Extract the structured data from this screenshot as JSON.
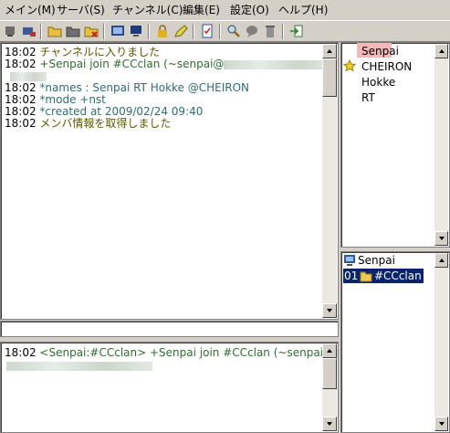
{
  "menu": [
    "メイン(M)",
    "サーバ(S)",
    "チャンネル(C)",
    "編集(E)",
    "設定(O)",
    "ヘルプ(H)"
  ],
  "toolbar_icons": [
    "server-list-icon",
    "connect-icon",
    "open-folder-icon",
    "folder-dark-icon",
    "folder-close-icon",
    "server-window-icon",
    "monitor-icon",
    "lock-icon",
    "pencil-icon",
    "checklist-icon",
    "search-icon",
    "chat-bubble-icon",
    "trash-icon",
    "exit-icon"
  ],
  "channel_log": [
    {
      "time": "18:02",
      "text": "チャンネルに入りました",
      "style": "dark"
    },
    {
      "time": "18:02",
      "text": "+Senpai join #CCclan (~senpai@",
      "style": "green"
    },
    {
      "time": "",
      "text": "",
      "style": "blurred"
    },
    {
      "time": "18:02",
      "text": "*names : Senpai RT Hokke @CHEIRON",
      "style": "teal"
    },
    {
      "time": "18:02",
      "text": "*mode +nst",
      "style": "teal"
    },
    {
      "time": "18:02",
      "text": "*created at 2009/02/24 09:40",
      "style": "teal"
    },
    {
      "time": "18:02",
      "text": "メンバ情報を取得しました",
      "style": "dark"
    }
  ],
  "nick_list": [
    {
      "name": "Senpai",
      "selected": true,
      "op": false
    },
    {
      "name": "CHEIRON",
      "selected": false,
      "op": true
    },
    {
      "name": "Hokke",
      "selected": false,
      "op": false
    },
    {
      "name": "RT",
      "selected": false,
      "op": false
    }
  ],
  "server_tree": {
    "server": "Senpai",
    "channel_index": "01",
    "channel": "#CCclan"
  },
  "console_log": [
    {
      "time": "18:02",
      "text": "<Senpai:#CCclan> +Senpai join #CCclan (~senpai@"
    }
  ],
  "colors": {
    "nick_selected_bg": "#f5b8b8",
    "tree_selected_bg": "#0a246a",
    "log_dark": "#5a5a00",
    "log_teal": "#2e6e6e",
    "log_green": "#2e6e2e"
  }
}
